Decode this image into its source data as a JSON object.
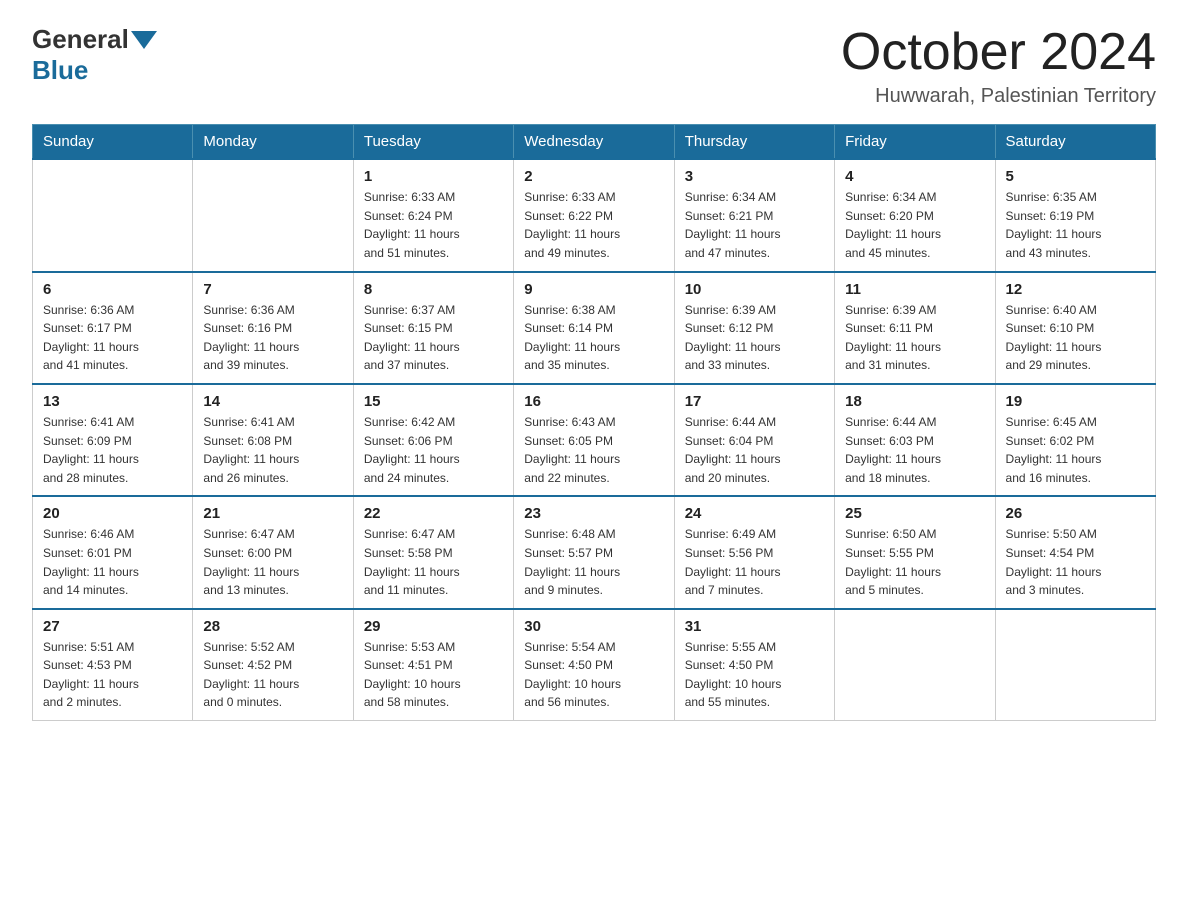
{
  "logo": {
    "general": "General",
    "blue": "Blue"
  },
  "title": "October 2024",
  "location": "Huwwarah, Palestinian Territory",
  "days_of_week": [
    "Sunday",
    "Monday",
    "Tuesday",
    "Wednesday",
    "Thursday",
    "Friday",
    "Saturday"
  ],
  "weeks": [
    [
      {
        "day": "",
        "info": ""
      },
      {
        "day": "",
        "info": ""
      },
      {
        "day": "1",
        "info": "Sunrise: 6:33 AM\nSunset: 6:24 PM\nDaylight: 11 hours\nand 51 minutes."
      },
      {
        "day": "2",
        "info": "Sunrise: 6:33 AM\nSunset: 6:22 PM\nDaylight: 11 hours\nand 49 minutes."
      },
      {
        "day": "3",
        "info": "Sunrise: 6:34 AM\nSunset: 6:21 PM\nDaylight: 11 hours\nand 47 minutes."
      },
      {
        "day": "4",
        "info": "Sunrise: 6:34 AM\nSunset: 6:20 PM\nDaylight: 11 hours\nand 45 minutes."
      },
      {
        "day": "5",
        "info": "Sunrise: 6:35 AM\nSunset: 6:19 PM\nDaylight: 11 hours\nand 43 minutes."
      }
    ],
    [
      {
        "day": "6",
        "info": "Sunrise: 6:36 AM\nSunset: 6:17 PM\nDaylight: 11 hours\nand 41 minutes."
      },
      {
        "day": "7",
        "info": "Sunrise: 6:36 AM\nSunset: 6:16 PM\nDaylight: 11 hours\nand 39 minutes."
      },
      {
        "day": "8",
        "info": "Sunrise: 6:37 AM\nSunset: 6:15 PM\nDaylight: 11 hours\nand 37 minutes."
      },
      {
        "day": "9",
        "info": "Sunrise: 6:38 AM\nSunset: 6:14 PM\nDaylight: 11 hours\nand 35 minutes."
      },
      {
        "day": "10",
        "info": "Sunrise: 6:39 AM\nSunset: 6:12 PM\nDaylight: 11 hours\nand 33 minutes."
      },
      {
        "day": "11",
        "info": "Sunrise: 6:39 AM\nSunset: 6:11 PM\nDaylight: 11 hours\nand 31 minutes."
      },
      {
        "day": "12",
        "info": "Sunrise: 6:40 AM\nSunset: 6:10 PM\nDaylight: 11 hours\nand 29 minutes."
      }
    ],
    [
      {
        "day": "13",
        "info": "Sunrise: 6:41 AM\nSunset: 6:09 PM\nDaylight: 11 hours\nand 28 minutes."
      },
      {
        "day": "14",
        "info": "Sunrise: 6:41 AM\nSunset: 6:08 PM\nDaylight: 11 hours\nand 26 minutes."
      },
      {
        "day": "15",
        "info": "Sunrise: 6:42 AM\nSunset: 6:06 PM\nDaylight: 11 hours\nand 24 minutes."
      },
      {
        "day": "16",
        "info": "Sunrise: 6:43 AM\nSunset: 6:05 PM\nDaylight: 11 hours\nand 22 minutes."
      },
      {
        "day": "17",
        "info": "Sunrise: 6:44 AM\nSunset: 6:04 PM\nDaylight: 11 hours\nand 20 minutes."
      },
      {
        "day": "18",
        "info": "Sunrise: 6:44 AM\nSunset: 6:03 PM\nDaylight: 11 hours\nand 18 minutes."
      },
      {
        "day": "19",
        "info": "Sunrise: 6:45 AM\nSunset: 6:02 PM\nDaylight: 11 hours\nand 16 minutes."
      }
    ],
    [
      {
        "day": "20",
        "info": "Sunrise: 6:46 AM\nSunset: 6:01 PM\nDaylight: 11 hours\nand 14 minutes."
      },
      {
        "day": "21",
        "info": "Sunrise: 6:47 AM\nSunset: 6:00 PM\nDaylight: 11 hours\nand 13 minutes."
      },
      {
        "day": "22",
        "info": "Sunrise: 6:47 AM\nSunset: 5:58 PM\nDaylight: 11 hours\nand 11 minutes."
      },
      {
        "day": "23",
        "info": "Sunrise: 6:48 AM\nSunset: 5:57 PM\nDaylight: 11 hours\nand 9 minutes."
      },
      {
        "day": "24",
        "info": "Sunrise: 6:49 AM\nSunset: 5:56 PM\nDaylight: 11 hours\nand 7 minutes."
      },
      {
        "day": "25",
        "info": "Sunrise: 6:50 AM\nSunset: 5:55 PM\nDaylight: 11 hours\nand 5 minutes."
      },
      {
        "day": "26",
        "info": "Sunrise: 5:50 AM\nSunset: 4:54 PM\nDaylight: 11 hours\nand 3 minutes."
      }
    ],
    [
      {
        "day": "27",
        "info": "Sunrise: 5:51 AM\nSunset: 4:53 PM\nDaylight: 11 hours\nand 2 minutes."
      },
      {
        "day": "28",
        "info": "Sunrise: 5:52 AM\nSunset: 4:52 PM\nDaylight: 11 hours\nand 0 minutes."
      },
      {
        "day": "29",
        "info": "Sunrise: 5:53 AM\nSunset: 4:51 PM\nDaylight: 10 hours\nand 58 minutes."
      },
      {
        "day": "30",
        "info": "Sunrise: 5:54 AM\nSunset: 4:50 PM\nDaylight: 10 hours\nand 56 minutes."
      },
      {
        "day": "31",
        "info": "Sunrise: 5:55 AM\nSunset: 4:50 PM\nDaylight: 10 hours\nand 55 minutes."
      },
      {
        "day": "",
        "info": ""
      },
      {
        "day": "",
        "info": ""
      }
    ]
  ]
}
